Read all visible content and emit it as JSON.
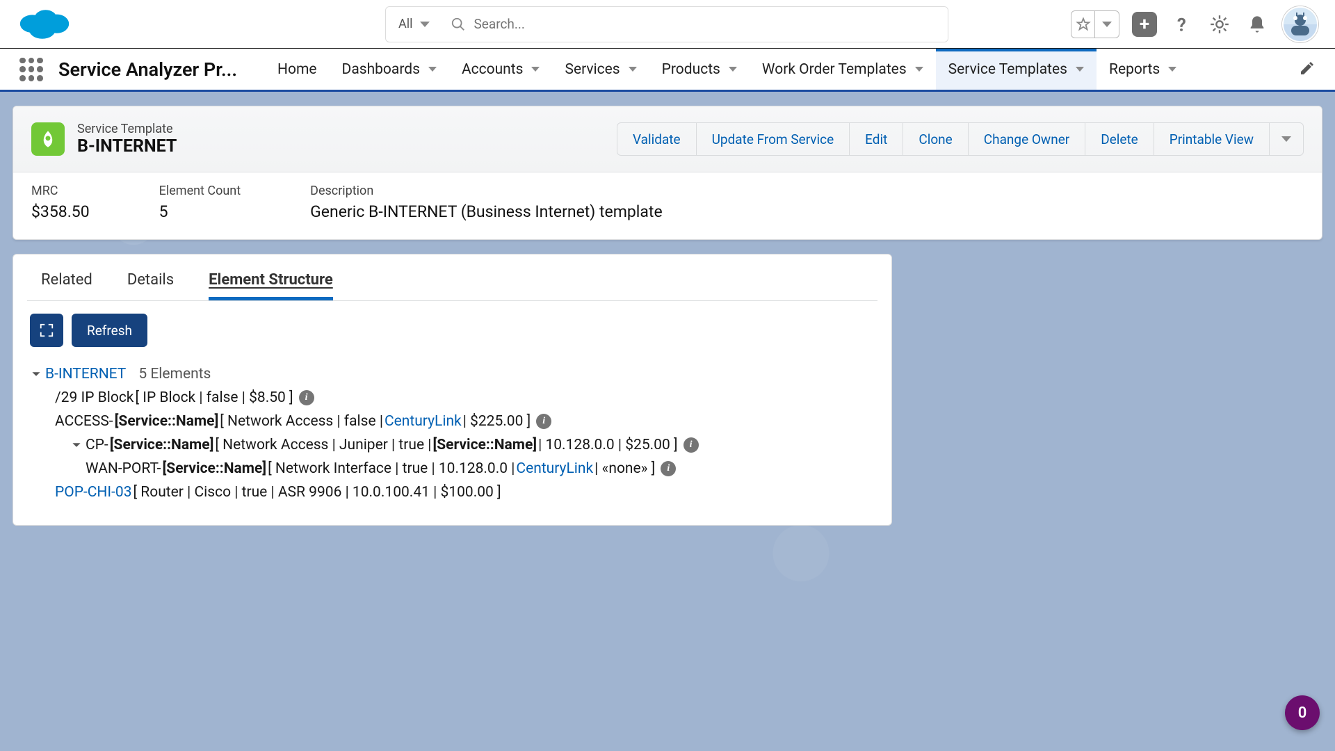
{
  "global": {
    "search_scope": "All",
    "search_placeholder": "Search..."
  },
  "app_title": "Service Analyzer Pr...",
  "nav": [
    {
      "label": "Home",
      "has_chevron": false
    },
    {
      "label": "Dashboards",
      "has_chevron": true
    },
    {
      "label": "Accounts",
      "has_chevron": true
    },
    {
      "label": "Services",
      "has_chevron": true
    },
    {
      "label": "Products",
      "has_chevron": true
    },
    {
      "label": "Work Order Templates",
      "has_chevron": true
    },
    {
      "label": "Service Templates",
      "has_chevron": true,
      "active": true
    },
    {
      "label": "Reports",
      "has_chevron": true
    }
  ],
  "record": {
    "object_label": "Service Template",
    "name": "B-INTERNET",
    "actions": [
      "Validate",
      "Update From Service",
      "Edit",
      "Clone",
      "Change Owner",
      "Delete",
      "Printable View"
    ],
    "fields": {
      "mrc_label": "MRC",
      "mrc_value": "$358.50",
      "count_label": "Element Count",
      "count_value": "5",
      "desc_label": "Description",
      "desc_value": "Generic B-INTERNET (Business Internet) template"
    }
  },
  "tabs": [
    "Related",
    "Details",
    "Element Structure"
  ],
  "toolbar": {
    "refresh": "Refresh"
  },
  "tree": {
    "root_name": "B-INTERNET",
    "root_count": "5 Elements",
    "r1_name": "/29 IP Block",
    "r1_info": " [ IP Block | false | $8.50 ] ",
    "r2_prefix": "ACCESS-",
    "r2_token": "[Service::Name]",
    "r2_mid": " [ Network Access | false | ",
    "r2_link": "CenturyLink",
    "r2_tail": " | $225.00 ] ",
    "r3_prefix": "CP-",
    "r3_token": "[Service::Name]",
    "r3_mid": " [ Network Access | Juniper | true | ",
    "r3_token2": "[Service::Name]",
    "r3_tail": " | 10.128.0.0 | $25.00 ] ",
    "r4_prefix": "WAN-PORT-",
    "r4_token": "[Service::Name]",
    "r4_mid": " [ Network Interface | true | 10.128.0.0 | ",
    "r4_link": "CenturyLink",
    "r4_tail": " | «none» ] ",
    "r5_link": "POP-CHI-03",
    "r5_tail": " [ Router | Cisco | true | ASR 9906 | 10.0.100.41 | $100.00 ]"
  },
  "fab": "0"
}
